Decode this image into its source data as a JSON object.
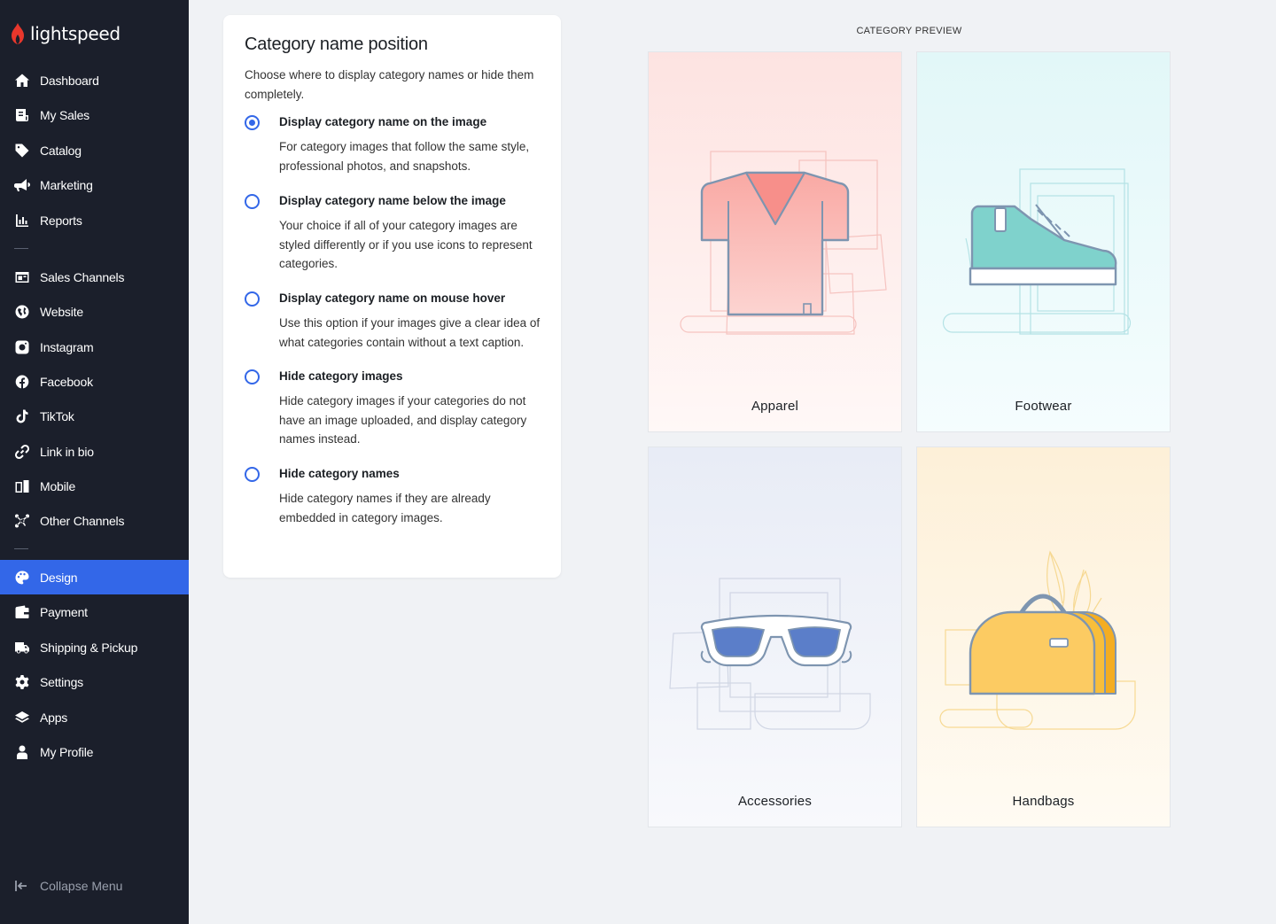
{
  "brand": {
    "name": "lightspeed",
    "accent": "#3367e8",
    "flame_color": "#e8372c"
  },
  "sidebar": {
    "groups": [
      [
        {
          "label": "Dashboard",
          "icon": "home-icon"
        },
        {
          "label": "My Sales",
          "icon": "receipt-icon"
        },
        {
          "label": "Catalog",
          "icon": "tag-icon"
        },
        {
          "label": "Marketing",
          "icon": "megaphone-icon"
        },
        {
          "label": "Reports",
          "icon": "bar-chart-icon"
        }
      ],
      [
        {
          "label": "Sales Channels",
          "icon": "store-icon"
        },
        {
          "label": "Website",
          "icon": "globe-icon"
        },
        {
          "label": "Instagram",
          "icon": "instagram-icon"
        },
        {
          "label": "Facebook",
          "icon": "facebook-icon"
        },
        {
          "label": "TikTok",
          "icon": "tiktok-icon"
        },
        {
          "label": "Link in bio",
          "icon": "link-icon"
        },
        {
          "label": "Mobile",
          "icon": "mobile-icon"
        },
        {
          "label": "Other Channels",
          "icon": "network-icon"
        }
      ],
      [
        {
          "label": "Design",
          "icon": "palette-icon",
          "active": true
        },
        {
          "label": "Payment",
          "icon": "wallet-icon"
        },
        {
          "label": "Shipping & Pickup",
          "icon": "truck-icon"
        },
        {
          "label": "Settings",
          "icon": "gear-icon"
        },
        {
          "label": "Apps",
          "icon": "layers-icon"
        },
        {
          "label": "My Profile",
          "icon": "user-icon"
        }
      ]
    ],
    "collapse_label": "Collapse Menu"
  },
  "settings": {
    "title": "Category name position",
    "description": "Choose where to display category names or hide them completely.",
    "options": [
      {
        "title": "Display category name on the image",
        "description": "For category images that follow the same style, professional photos, and snapshots.",
        "selected": true
      },
      {
        "title": "Display category name below the image",
        "description": "Your choice if all of your category images are styled differently or if you use icons to represent categories.",
        "selected": false
      },
      {
        "title": "Display category name on mouse hover",
        "description": "Use this option if your images give a clear idea of what categories contain without a text caption.",
        "selected": false
      },
      {
        "title": "Hide category images",
        "description": "Hide category images if your categories do not have an image uploaded, and display category names instead.",
        "selected": false
      },
      {
        "title": "Hide category names",
        "description": "Hide category names if they are already embedded in category images.",
        "selected": false
      }
    ]
  },
  "preview": {
    "label": "CATEGORY PREVIEW",
    "tiles": [
      {
        "name": "Apparel",
        "icon": "t-shirt-icon",
        "bg_top": "#fde3e1",
        "bg_bottom": "#fff6f5"
      },
      {
        "name": "Footwear",
        "icon": "sneaker-icon",
        "bg_top": "#e3f7f8",
        "bg_bottom": "#f4fcfd"
      },
      {
        "name": "Accessories",
        "icon": "sunglasses-icon",
        "bg_top": "#e8ecf6",
        "bg_bottom": "#f7f8fb"
      },
      {
        "name": "Handbags",
        "icon": "handbag-icon",
        "bg_top": "#fdf0d8",
        "bg_bottom": "#fffaf0"
      }
    ]
  }
}
